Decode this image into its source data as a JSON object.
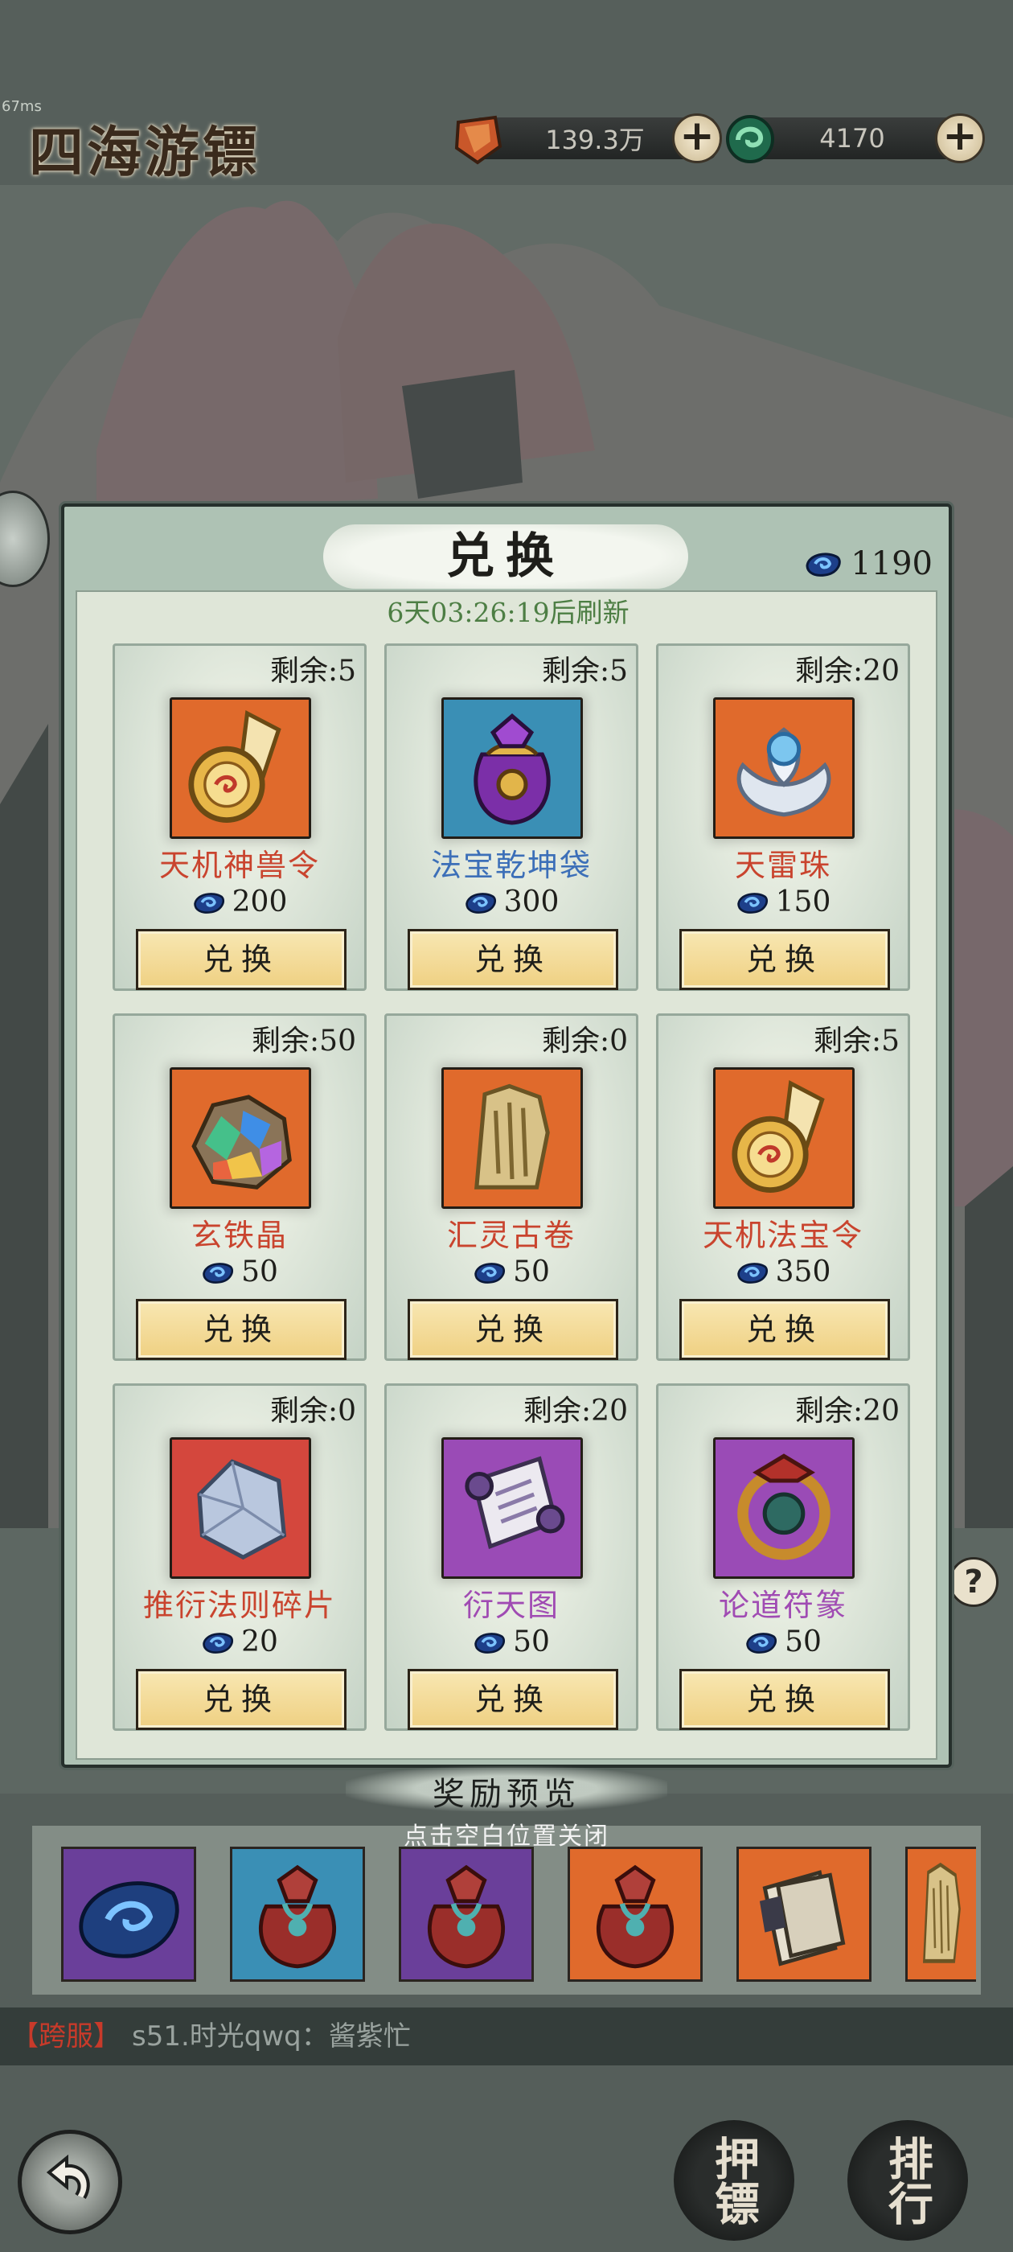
{
  "colors": {
    "name_red": "#c9442e",
    "name_blue": "#3c6fb8",
    "name_purple": "#a04bb3",
    "refresh_green": "#4d7e44",
    "tile_orange": "#e06a2c",
    "tile_blue": "#3a8fb5",
    "tile_red": "#d4473d",
    "tile_purple": "#9a4bb6"
  },
  "hud": {
    "fps": "67ms",
    "title": "四海游镖",
    "ore_amount": "139.3万",
    "jade_amount": "4170",
    "plus": "+"
  },
  "modal": {
    "title": "兑换",
    "balance": "1190",
    "refresh_text": "6天03:26:19后刷新",
    "exchange_label": "兑换",
    "items": [
      {
        "remaining": "剩余:5",
        "name": "天机神兽令",
        "cost": "200",
        "name_color": "#c9442e",
        "tile": "#e06a2c",
        "icon": "medal-token-icon"
      },
      {
        "remaining": "剩余:5",
        "name": "法宝乾坤袋",
        "cost": "300",
        "name_color": "#3c6fb8",
        "tile": "#3a8fb5",
        "icon": "treasure-bag-icon"
      },
      {
        "remaining": "剩余:20",
        "name": "天雷珠",
        "cost": "150",
        "name_color": "#c9442e",
        "tile": "#e06a2c",
        "icon": "lotus-pearl-icon"
      },
      {
        "remaining": "剩余:50",
        "name": "玄铁晶",
        "cost": "50",
        "name_color": "#c9442e",
        "tile": "#e06a2c",
        "icon": "crystal-ore-icon"
      },
      {
        "remaining": "剩余:0",
        "name": "汇灵古卷",
        "cost": "50",
        "name_color": "#c9442e",
        "tile": "#e06a2c",
        "icon": "ancient-scroll-icon"
      },
      {
        "remaining": "剩余:5",
        "name": "天机法宝令",
        "cost": "350",
        "name_color": "#c9442e",
        "tile": "#e06a2c",
        "icon": "medal-token-icon"
      },
      {
        "remaining": "剩余:0",
        "name": "推衍法则碎片",
        "cost": "20",
        "name_color": "#c9442e",
        "tile": "#d4473d",
        "icon": "crystal-shard-icon"
      },
      {
        "remaining": "剩余:20",
        "name": "衍天图",
        "cost": "50",
        "name_color": "#a04bb3",
        "tile": "#9a4bb6",
        "icon": "scroll-map-icon"
      },
      {
        "remaining": "剩余:20",
        "name": "论道符篆",
        "cost": "50",
        "name_color": "#a04bb3",
        "tile": "#9a4bb6",
        "icon": "talisman-ring-icon"
      }
    ]
  },
  "rewards": {
    "title": "奖励预览",
    "close_hint": "点击空白位置关闭",
    "items": [
      {
        "icon": "jade-stone-icon",
        "tile": "#6a3f9a"
      },
      {
        "icon": "red-bag-icon",
        "tile": "#3a8fb5"
      },
      {
        "icon": "red-bag-icon",
        "tile": "#6a3f9a"
      },
      {
        "icon": "red-bag-icon",
        "tile": "#e06a2c"
      },
      {
        "icon": "scroll-pages-icon",
        "tile": "#e06a2c"
      },
      {
        "icon": "ancient-scroll-icon",
        "tile": "#e06a2c"
      }
    ]
  },
  "chat": {
    "tag": "【跨服】",
    "message": "s51.时光qwq：酱紫忙"
  },
  "nav": {
    "escort": "押镖",
    "rank": "排行",
    "help": "?"
  }
}
